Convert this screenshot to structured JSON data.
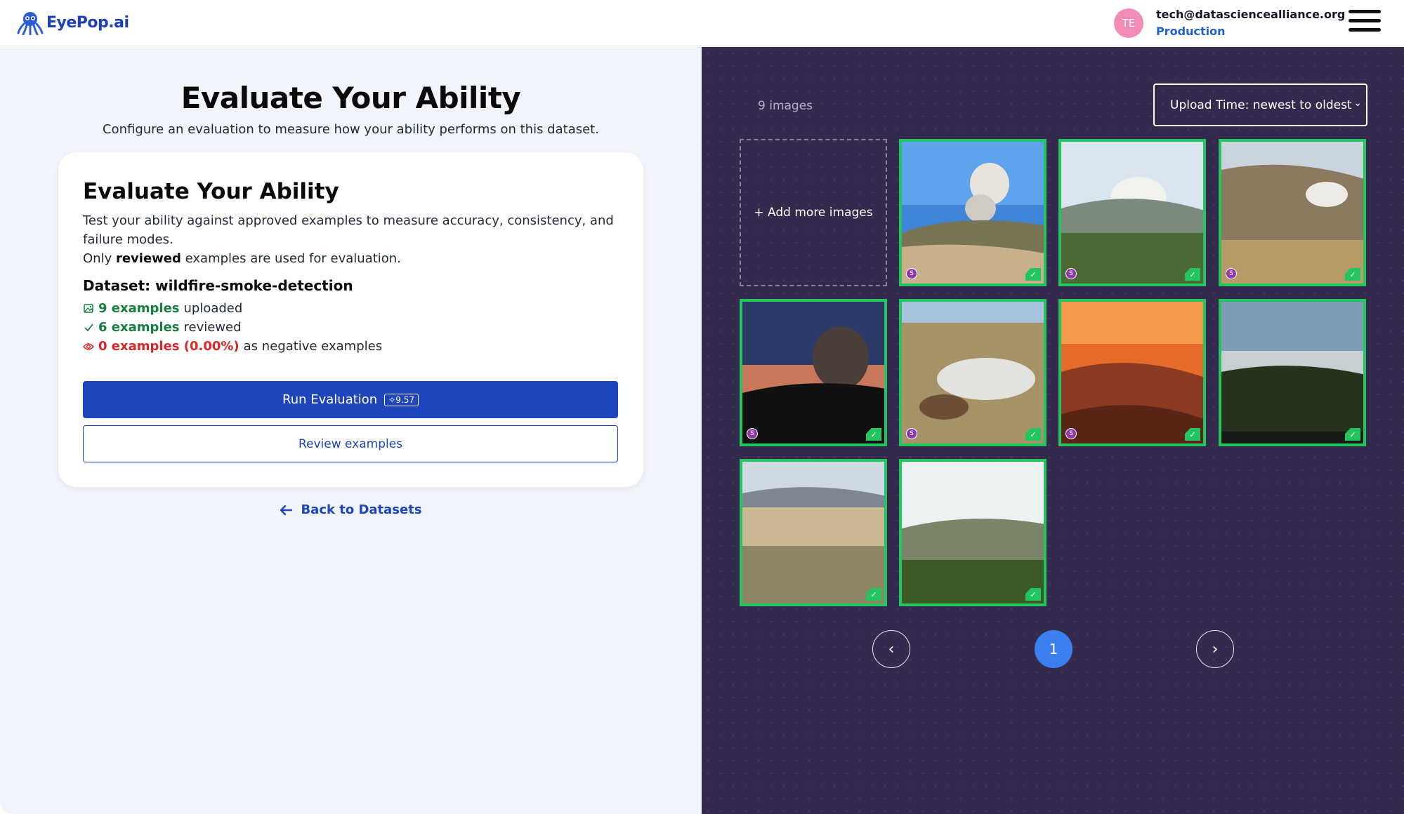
{
  "header": {
    "brand": "EyePop.ai",
    "avatar_initials": "TE",
    "user_email": "tech@datasciencealliance.org",
    "environment": "Production"
  },
  "main": {
    "title": "Evaluate Your Ability",
    "subtitle": "Configure an evaluation to measure how your ability performs on this dataset.",
    "card": {
      "title": "Evaluate Your Ability",
      "desc_line1": "Test your ability against approved examples to measure accuracy, consistency, and failure modes.",
      "desc_only": "Only",
      "desc_reviewed": "reviewed",
      "desc_tail": "examples are used for evaluation.",
      "dataset_label": "Dataset: wildfire-smoke-detection",
      "stats": {
        "uploaded_count": "9 examples",
        "uploaded_suffix": "uploaded",
        "reviewed_count": "6 examples",
        "reviewed_suffix": "reviewed",
        "negative_count": "0 examples (0.00%)",
        "negative_suffix": "as negative examples"
      },
      "run_button": "Run Evaluation",
      "run_credits": "9.57",
      "review_button": "Review examples"
    },
    "back_link": "Back to Datasets"
  },
  "gallery": {
    "image_count": "9 images",
    "sort_value": "Upload Time: newest to oldest",
    "add_label": "+ Add more images",
    "pagination": {
      "prev": "‹",
      "current": "1",
      "next": "›"
    },
    "badge_letter": "S"
  }
}
